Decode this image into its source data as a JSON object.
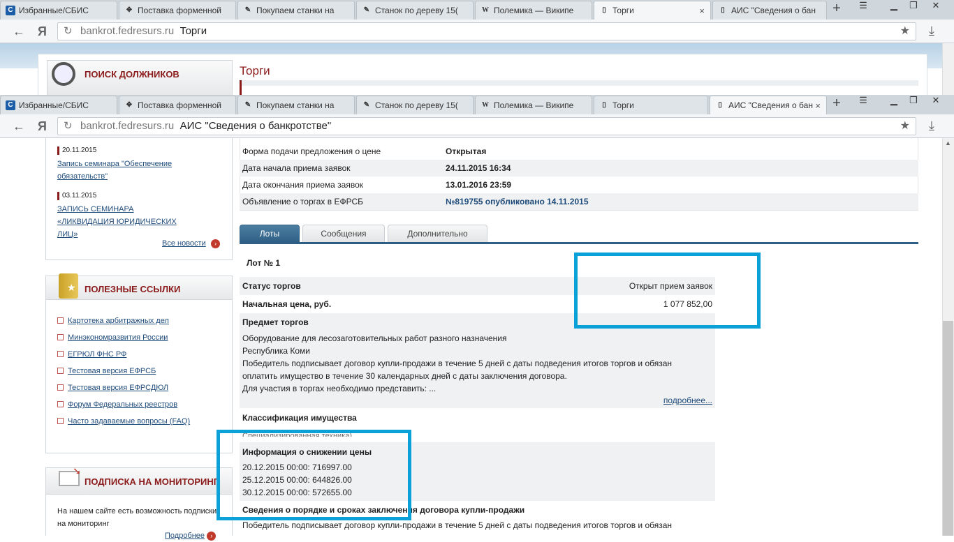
{
  "browser_back": {
    "tabs": [
      "Избранные/СБИС",
      "Поставка форменной",
      "Покупаем станки на",
      "Станок по дереву 15(",
      "Полемика — Википе",
      "Торги",
      "АИС \"Сведения о бан"
    ],
    "active_tab": 5,
    "url_domain": "bankrot.fedresurs.ru",
    "url_title": "Торги"
  },
  "browser_front": {
    "tabs": [
      "Избранные/СБИС",
      "Поставка форменной",
      "Покупаем станки на",
      "Станок по дереву 15(",
      "Полемика — Википе",
      "Торги",
      "АИС \"Сведения о бан"
    ],
    "active_tab": 6,
    "url_domain": "bankrot.fedresurs.ru",
    "url_title": "АИС \"Сведения о банкротстве\""
  },
  "back_page": {
    "search_title": "ПОИСК ДОЛЖНИКОВ",
    "page_title": "Торги"
  },
  "news": [
    {
      "date": "20.11.2015",
      "text": "Запись семинара \"Обеспечение обязательств\""
    },
    {
      "date": "03.11.2015",
      "text": "ЗАПИСЬ СЕМИНАРА «ЛИКВИДАЦИЯ ЮРИДИЧЕСКИХ ЛИЦ»"
    }
  ],
  "all_news": "Все новости",
  "links_title": "ПОЛЕЗНЫЕ ССЫЛКИ",
  "links": [
    "Картотека арбитражных дел",
    "Минэкономразвития России",
    "ЕГРЮЛ ФНС РФ",
    "Тестовая версия ЕФРСБ",
    "Тестовая версия ЕФРСДЮЛ",
    "Форум Федеральных реестров",
    "Часто задаваемые вопросы (FAQ)"
  ],
  "subscribe": {
    "title": "ПОДПИСКА НА МОНИТОРИНГ",
    "text1": "На нашем сайте есть возможность подписки",
    "text2": "на мониторинг",
    "more": "Подробнее"
  },
  "info_rows": [
    {
      "k": "Форма подачи предложения о цене",
      "v": "Открытая"
    },
    {
      "k": "Дата начала приема заявок",
      "v": "24.11.2015 16:34"
    },
    {
      "k": "Дата окончания приема заявок",
      "v": "13.01.2016 23:59"
    },
    {
      "k": "Объявление о торгах в ЕФРСБ",
      "v": "№819755 опубликовано 14.11.2015"
    }
  ],
  "lot_tabs": [
    "Лоты",
    "Сообщения",
    "Дополнительно"
  ],
  "lot": {
    "title": "Лот № 1",
    "status_label": "Статус торгов",
    "status_value": "Открыт прием заявок",
    "price_label": "Начальная цена, руб.",
    "price_value": "1 077 852,00",
    "subject_label": "Предмет торгов",
    "subject_lines": [
      "Оборудование для лесозаготовительных работ разного назначения",
      "Республика Коми",
      "Победитель подписывает договор купли-продажи в течение 5 дней с даты подведения итогов торгов и обязан",
      "оплатить имущество в течение 30 календарных дней с даты заключения договора.",
      "Для участия в торгах необходимо представить: ..."
    ],
    "more": "подробнее...",
    "class_label": "Классификация имущества",
    "class_value": "Специализированная техника)",
    "reduction_label": "Информация о снижении цены",
    "reductions": [
      "20.12.2015 00:00: 716997.00",
      "25.12.2015 00:00: 644826.00",
      "30.12.2015 00:00: 572655.00"
    ],
    "contract_label": "Сведения о порядке и сроках заключения договора купли-продажи",
    "contract_text": "Победитель подписывает договор купли-продажи в течение 5 дней с даты подведения итогов торгов и обязан"
  },
  "colors": {
    "highlight": "#0aa0d8",
    "brand": "#8b1a1a",
    "link": "#1f4b7a",
    "tab_active": "#2e5e83"
  }
}
